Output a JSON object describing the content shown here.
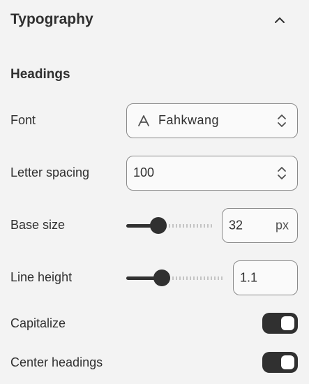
{
  "section": {
    "title": "Typography",
    "collapse_icon": "chevron-up-icon"
  },
  "headings": {
    "title": "Headings",
    "font": {
      "label": "Font",
      "value": "Fahkwang",
      "icon": "font-letter-icon",
      "stepper_icon": "chevron-up-down-icon"
    },
    "letter_spacing": {
      "label": "Letter spacing",
      "value": "100",
      "stepper_icon": "chevron-up-down-icon"
    },
    "base_size": {
      "label": "Base size",
      "value": "32",
      "unit": "px",
      "slider_fraction": 0.3
    },
    "line_height": {
      "label": "Line height",
      "value": "1.1",
      "slider_fraction": 0.3
    },
    "capitalize": {
      "label": "Capitalize",
      "on": true
    },
    "center_headings": {
      "label": "Center headings",
      "on": true
    }
  },
  "colors": {
    "text": "#303030",
    "toggle_on": "#303030",
    "field_border": "#8a8a8a",
    "background": "#f3f3f3"
  }
}
